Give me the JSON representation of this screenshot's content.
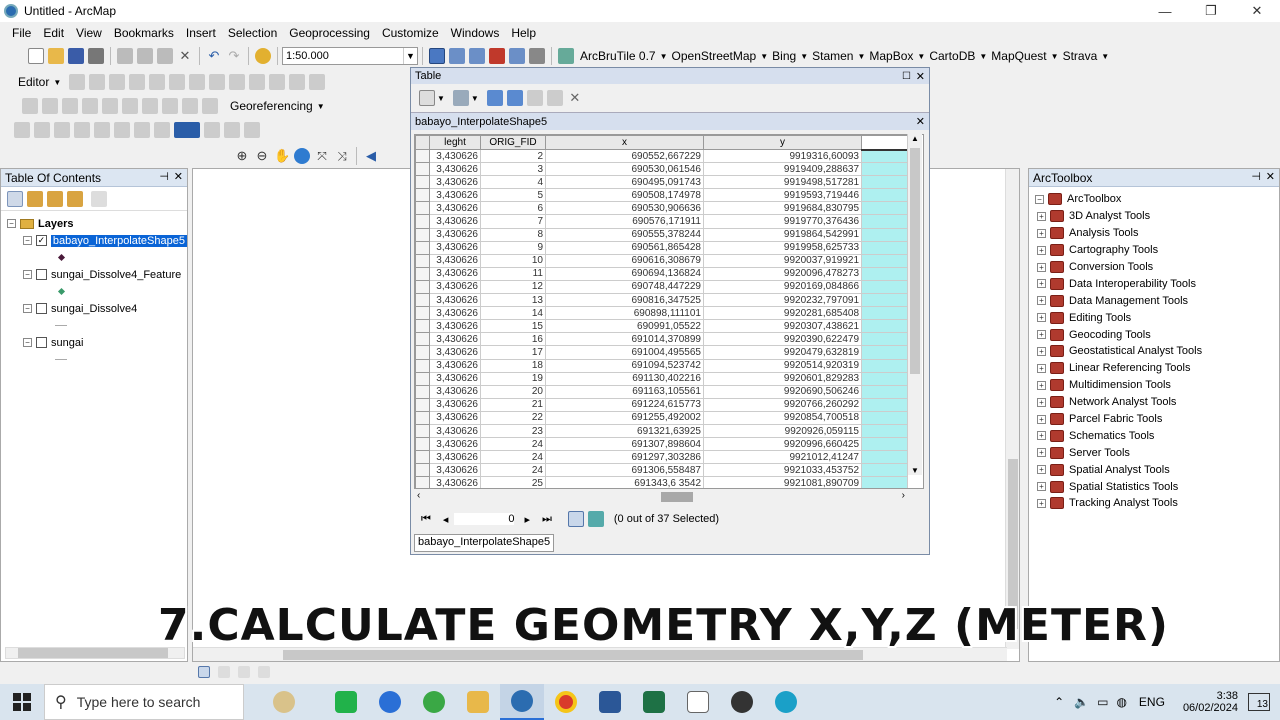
{
  "window": {
    "title": "Untitled - ArcMap",
    "minimize": "—",
    "maximize": "❐",
    "close": "✕"
  },
  "menu": [
    "File",
    "Edit",
    "View",
    "Bookmarks",
    "Insert",
    "Selection",
    "Geoprocessing",
    "Customize",
    "Windows",
    "Help"
  ],
  "toolbar": {
    "scale": "1:50.000",
    "arcbrutile": "ArcBruTile 0.7",
    "basemaps": [
      "OpenStreetMap",
      "Bing",
      "Stamen",
      "MapBox",
      "CartoDB",
      "MapQuest",
      "Strava"
    ],
    "editor": "Editor",
    "georeferencing": "Georeferencing"
  },
  "toc": {
    "title": "Table Of Contents",
    "root": "Layers",
    "layers": [
      {
        "name": "babayo_InterpolateShape5",
        "checked": true,
        "selected": true
      },
      {
        "name": "sungai_Dissolve4_Feature",
        "checked": false,
        "selected": false
      },
      {
        "name": "sungai_Dissolve4",
        "checked": false,
        "selected": false
      },
      {
        "name": "sungai",
        "checked": false,
        "selected": false
      }
    ]
  },
  "arctoolbox": {
    "title": "ArcToolbox",
    "root": "ArcToolbox",
    "items": [
      "3D Analyst Tools",
      "Analysis Tools",
      "Cartography Tools",
      "Conversion Tools",
      "Data Interoperability Tools",
      "Data Management Tools",
      "Editing Tools",
      "Geocoding Tools",
      "Geostatistical Analyst Tools",
      "Linear Referencing Tools",
      "Multidimension Tools",
      "Network Analyst Tools",
      "Parcel Fabric Tools",
      "Schematics Tools",
      "Server Tools",
      "Spatial Analyst Tools",
      "Spatial Statistics Tools",
      "Tracking Analyst Tools"
    ]
  },
  "table": {
    "window_title": "Table",
    "layer_tab": "babayo_InterpolateShape5",
    "columns": [
      "leght",
      "ORIG_FID",
      "x",
      "y"
    ],
    "rows": [
      [
        "3,430626",
        "2",
        "690552,667229",
        "9919316,60093"
      ],
      [
        "3,430626",
        "3",
        "690530,061546",
        "9919409,288637"
      ],
      [
        "3,430626",
        "4",
        "690495,091743",
        "9919498,517281"
      ],
      [
        "3,430626",
        "5",
        "690508,174978",
        "9919593,719446"
      ],
      [
        "3,430626",
        "6",
        "690530,906636",
        "9919684,830795"
      ],
      [
        "3,430626",
        "7",
        "690576,171911",
        "9919770,376436"
      ],
      [
        "3,430626",
        "8",
        "690555,378244",
        "9919864,542991"
      ],
      [
        "3,430626",
        "9",
        "690561,865428",
        "9919958,625733"
      ],
      [
        "3,430626",
        "10",
        "690616,308679",
        "9920037,919921"
      ],
      [
        "3,430626",
        "11",
        "690694,136824",
        "9920096,478273"
      ],
      [
        "3,430626",
        "12",
        "690748,447229",
        "9920169,084866"
      ],
      [
        "3,430626",
        "13",
        "690816,347525",
        "9920232,797091"
      ],
      [
        "3,430626",
        "14",
        "690898,111101",
        "9920281,685408"
      ],
      [
        "3,430626",
        "15",
        "690991,05522",
        "9920307,438621"
      ],
      [
        "3,430626",
        "16",
        "691014,370899",
        "9920390,622479"
      ],
      [
        "3,430626",
        "17",
        "691004,495565",
        "9920479,632819"
      ],
      [
        "3,430626",
        "18",
        "691094,523742",
        "9920514,920319"
      ],
      [
        "3,430626",
        "19",
        "691130,402216",
        "9920601,829283"
      ],
      [
        "3,430626",
        "20",
        "691163,105561",
        "9920690,506246"
      ],
      [
        "3,430626",
        "21",
        "691224,615773",
        "9920766,260292"
      ],
      [
        "3,430626",
        "22",
        "691255,492002",
        "9920854,700518"
      ],
      [
        "3,430626",
        "23",
        "691321,63925",
        "9920926,059115"
      ],
      [
        "3,430626",
        "24",
        "691307,898604",
        "9920996,660425"
      ],
      [
        "3,430626",
        "24",
        "691297,303286",
        "9921012,41247"
      ],
      [
        "3,430626",
        "24",
        "691306,558487",
        "9921033,453752"
      ],
      [
        "3,430626",
        "25",
        "691343,6 3542",
        "9921081,890709"
      ]
    ],
    "record_number": "0",
    "selection_status": "(0 out of 37 Selected)"
  },
  "caption": "7.CALCULATE GEOMETRY X,Y,Z (METER)",
  "taskbar": {
    "search_placeholder": "Type here to search",
    "language": "ENG",
    "time": "3:38",
    "date": "06/02/2024",
    "notifications": "13"
  },
  "colors": {
    "selection_blue": "#0a64d6",
    "cyan_column": "#aef0f0",
    "panel_header": "#dce6f2",
    "taskbar": "#d9e4ee"
  }
}
